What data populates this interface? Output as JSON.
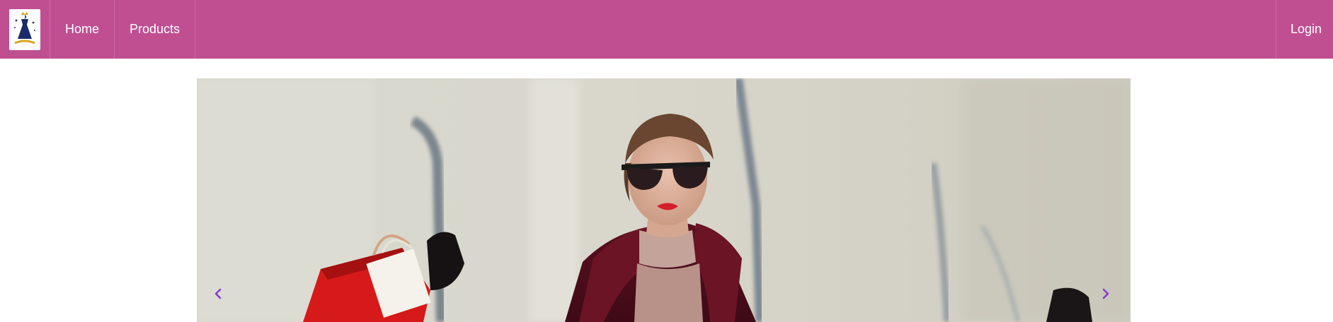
{
  "navbar": {
    "brand_logo": "dress-logo-icon",
    "background_color": "#c04f92",
    "left_links": [
      {
        "label": "Home"
      },
      {
        "label": "Products"
      }
    ],
    "right_links": [
      {
        "label": "Login"
      }
    ]
  },
  "carousel": {
    "slide_image": "woman-with-shopping-bags-photo",
    "prev_icon": "chevron-left-icon",
    "next_icon": "chevron-right-icon",
    "control_color": "#8a3ad6"
  }
}
